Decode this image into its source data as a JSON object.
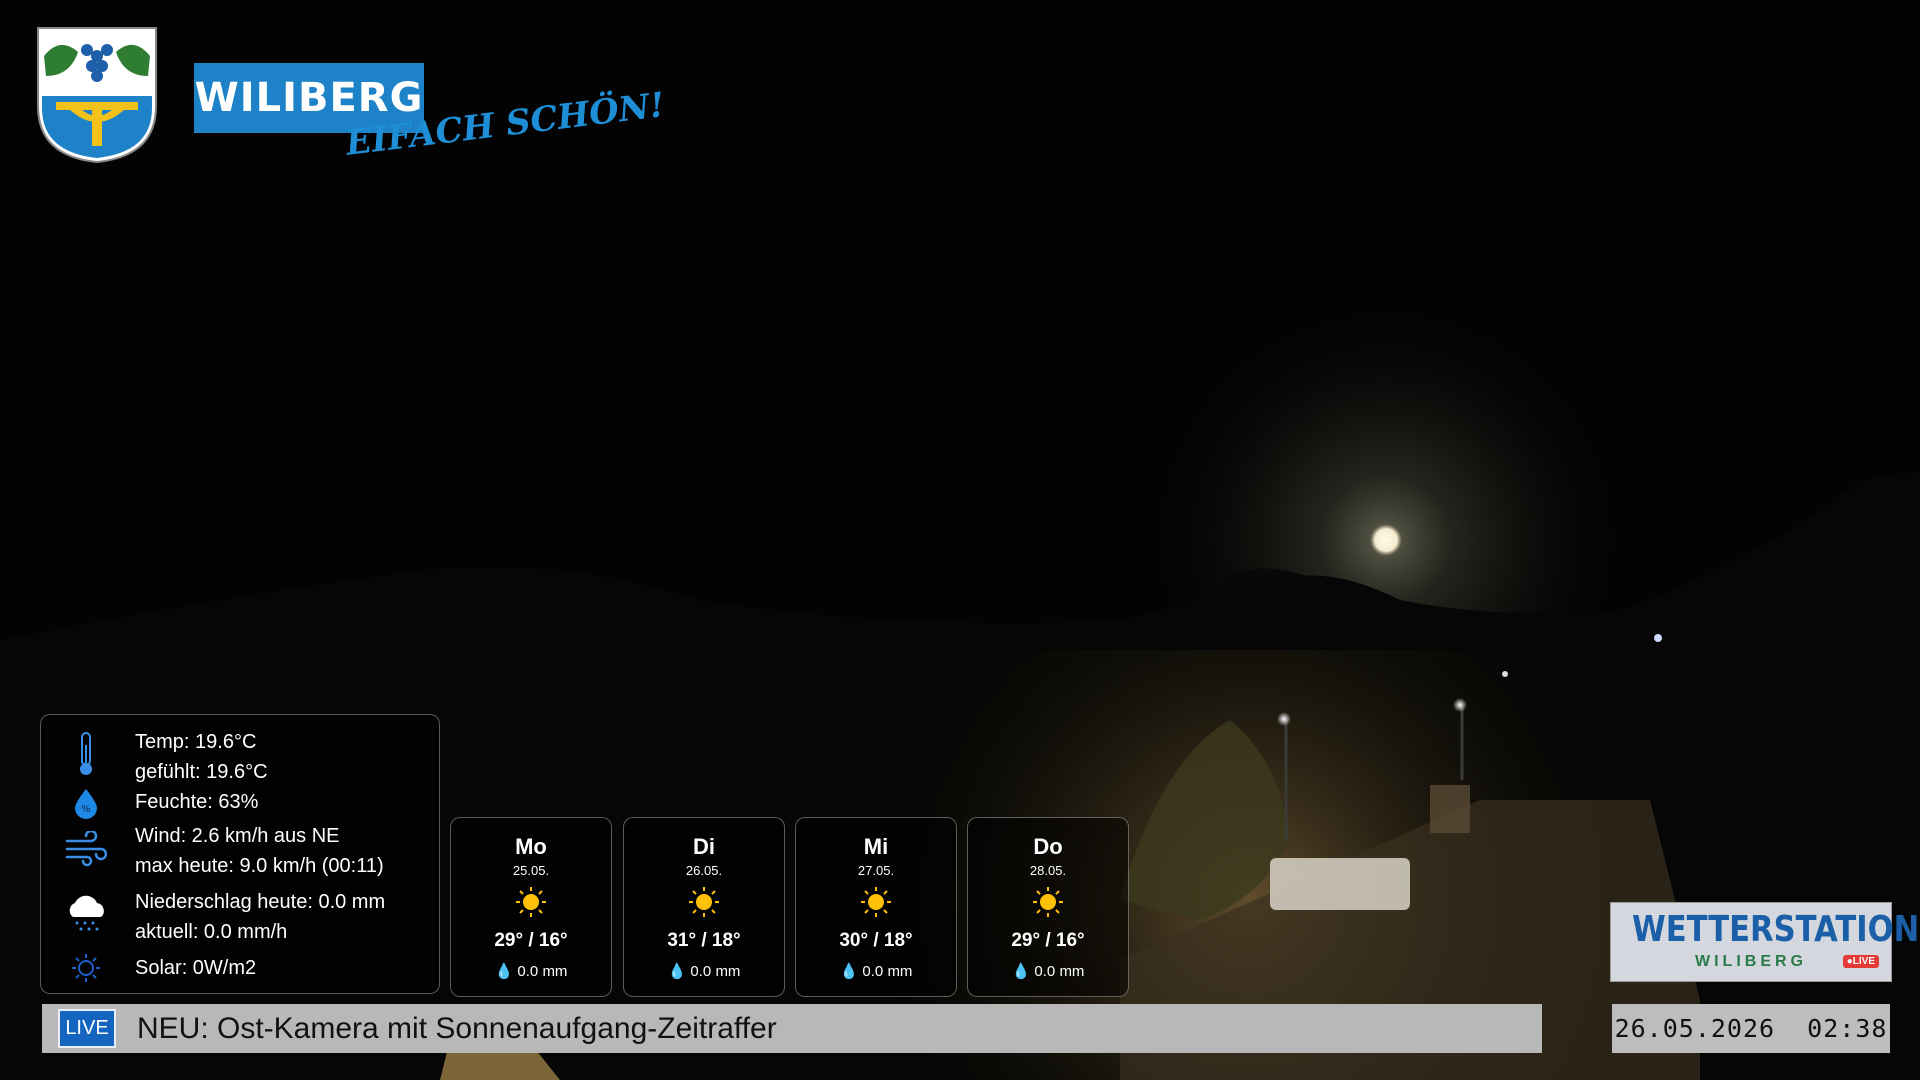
{
  "brand": {
    "name": "WILIBERG",
    "slogan": "EIFACH SCHÖN!"
  },
  "weather": {
    "temp": "Temp: 19.6°C",
    "feels": "gefühlt: 19.6°C",
    "humidity": "Feuchte: 63%",
    "wind": "Wind: 2.6 km/h aus NE",
    "wind_max": "max heute: 9.0 km/h (00:11)",
    "precip": "Niederschlag heute: 0.0 mm",
    "precip_now": "aktuell: 0.0 mm/h",
    "solar": "Solar: 0W/m2",
    "icons": [
      "thermometer-icon",
      "humidity-drop-icon",
      "wind-icon",
      "rain-cloud-icon",
      "sun-icon"
    ]
  },
  "forecast": [
    {
      "day": "Mo",
      "date": "25.05.",
      "temp": "29° / 16°",
      "rain": "0.0 mm"
    },
    {
      "day": "Di",
      "date": "26.05.",
      "temp": "31° / 18°",
      "rain": "0.0 mm"
    },
    {
      "day": "Mi",
      "date": "27.05.",
      "temp": "30° / 18°",
      "rain": "0.0 mm"
    },
    {
      "day": "Do",
      "date": "28.05.",
      "temp": "29° / 16°",
      "rain": "0.0 mm"
    }
  ],
  "ticker": {
    "badge": "LIVE",
    "text": "NEU: Ost-Kamera mit Sonnenaufgang-Zeitraffer"
  },
  "station": {
    "title": "WETTERSTATION",
    "subtitle": "WILIBERG",
    "live": "●LIVE"
  },
  "clock": "26.05.2026  02:38",
  "colors": {
    "brand_blue": "#1d82c7",
    "ticker_bg": "#b8b8b8",
    "live_blue": "#1565c0"
  }
}
